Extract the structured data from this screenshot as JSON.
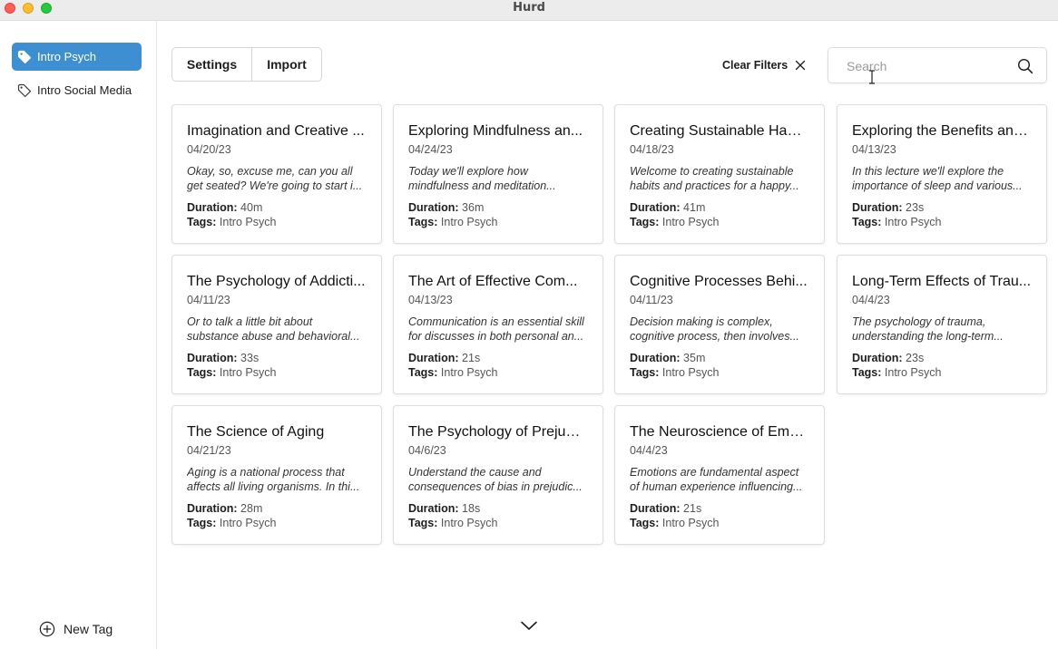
{
  "window": {
    "title": "Hurd"
  },
  "sidebar": {
    "tags": [
      {
        "label": "Intro Psych",
        "active": true
      },
      {
        "label": "Intro Social Media",
        "active": false
      }
    ],
    "new_tag_label": "New Tag"
  },
  "toolbar": {
    "settings_label": "Settings",
    "import_label": "Import",
    "clear_filters_label": "Clear Filters",
    "search_placeholder": "Search",
    "search_value": ""
  },
  "colors": {
    "accent": "#3d8fd1",
    "traffic_close": "#ff5f57",
    "traffic_min": "#febc2e",
    "traffic_max": "#28c840"
  },
  "cards": [
    {
      "title": "Imagination and Creative ...",
      "date": "04/20/23",
      "excerpt": "Okay, so, excuse me, can you all get seated? We're going to start i...",
      "duration_label": "Duration:",
      "duration": "40m",
      "tags_label": "Tags:",
      "tags": "Intro Psych"
    },
    {
      "title": "Exploring Mindfulness an...",
      "date": "04/24/23",
      "excerpt": "Today we'll explore how mindfulness and meditation...",
      "duration_label": "Duration:",
      "duration": "36m",
      "tags_label": "Tags:",
      "tags": "Intro Psych"
    },
    {
      "title": "Creating Sustainable Habi...",
      "date": "04/18/23",
      "excerpt": "Welcome to creating sustainable habits and practices for a happy...",
      "duration_label": "Duration:",
      "duration": "41m",
      "tags_label": "Tags:",
      "tags": "Intro Psych"
    },
    {
      "title": "Exploring the Benefits and...",
      "date": "04/13/23",
      "excerpt": "In this lecture we'll explore the importance of sleep and various...",
      "duration_label": "Duration:",
      "duration": "23s",
      "tags_label": "Tags:",
      "tags": "Intro Psych"
    },
    {
      "title": "The Psychology of Addicti...",
      "date": "04/11/23",
      "excerpt": "Or to talk a little bit about substance abuse and behavioral...",
      "duration_label": "Duration:",
      "duration": "33s",
      "tags_label": "Tags:",
      "tags": "Intro Psych"
    },
    {
      "title": "The Art of Effective Com...",
      "date": "04/13/23",
      "excerpt": "Communication is an essential skill for discusses in both personal an...",
      "duration_label": "Duration:",
      "duration": "21s",
      "tags_label": "Tags:",
      "tags": "Intro Psych"
    },
    {
      "title": "Cognitive Processes Behi...",
      "date": "04/11/23",
      "excerpt": "Decision making is complex, cognitive process, then involves...",
      "duration_label": "Duration:",
      "duration": "35m",
      "tags_label": "Tags:",
      "tags": "Intro Psych"
    },
    {
      "title": "Long-Term Effects of Trau...",
      "date": "04/4/23",
      "excerpt": "The psychology of trauma, understanding the long-term...",
      "duration_label": "Duration:",
      "duration": "23s",
      "tags_label": "Tags:",
      "tags": "Intro Psych"
    },
    {
      "title": "The Science of Aging",
      "date": "04/21/23",
      "excerpt": "Aging is a national process that affects all living organisms. In thi...",
      "duration_label": "Duration:",
      "duration": "28m",
      "tags_label": "Tags:",
      "tags": "Intro Psych"
    },
    {
      "title": "The Psychology of Prejudi...",
      "date": "04/6/23",
      "excerpt": "Understand the cause and consequences of bias in prejudic...",
      "duration_label": "Duration:",
      "duration": "18s",
      "tags_label": "Tags:",
      "tags": "Intro Psych"
    },
    {
      "title": "The Neuroscience of Emo...",
      "date": "04/4/23",
      "excerpt": "Emotions are fundamental aspect of human experience influencing...",
      "duration_label": "Duration:",
      "duration": "21s",
      "tags_label": "Tags:",
      "tags": "Intro Psych"
    }
  ]
}
